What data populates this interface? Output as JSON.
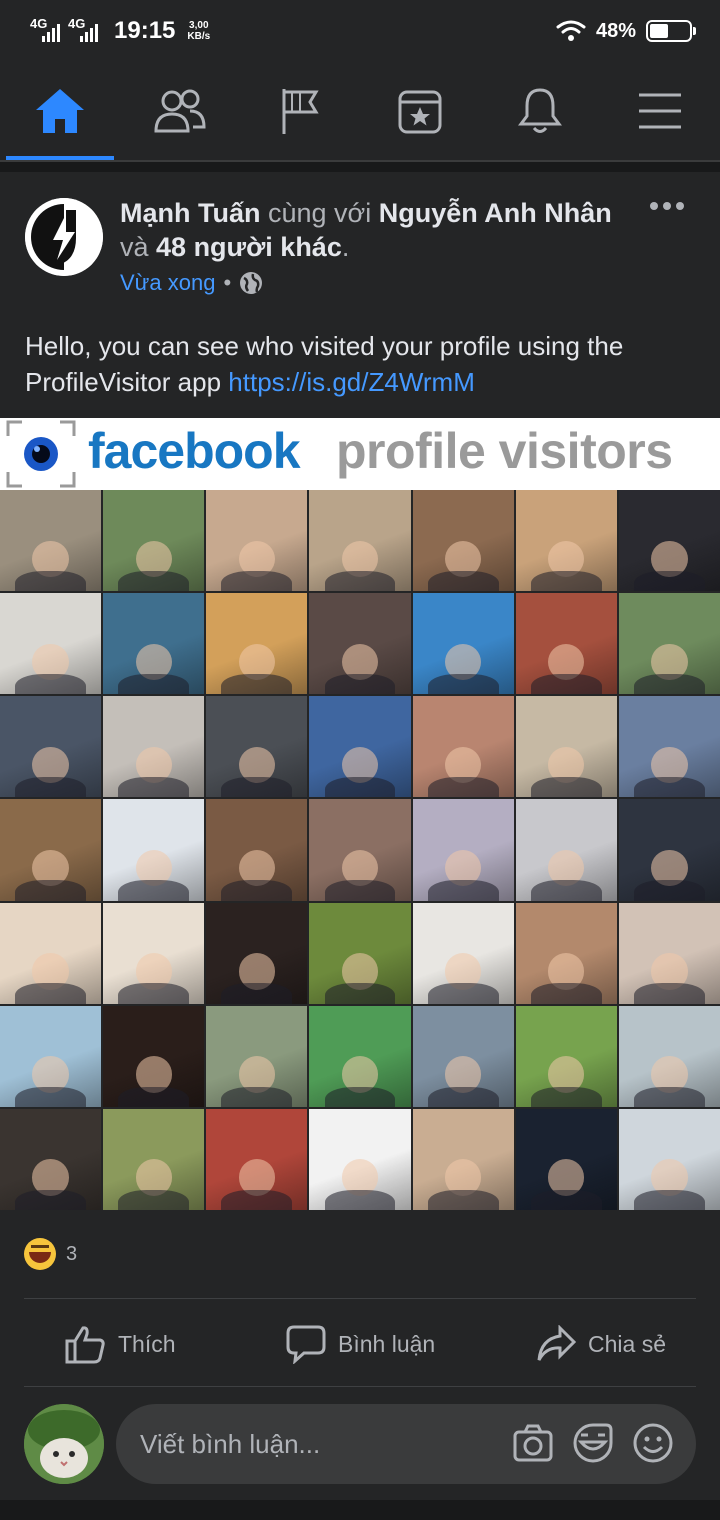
{
  "status": {
    "network1": "4G",
    "network2": "4G",
    "time": "19:15",
    "speed_value": "3,00",
    "speed_unit": "KB/s",
    "battery_pct": "48%",
    "battery_level": 0.48
  },
  "nav": {
    "items": [
      {
        "name": "home",
        "active": true
      },
      {
        "name": "friends",
        "active": false
      },
      {
        "name": "pages",
        "active": false
      },
      {
        "name": "events",
        "active": false
      },
      {
        "name": "notifications",
        "active": false
      },
      {
        "name": "menu",
        "active": false
      }
    ],
    "accent": "#2d88ff"
  },
  "post": {
    "author": "Mạnh Tuấn",
    "with_text": " cùng với ",
    "tagged": "Nguyễn Anh Nhân",
    "and_text": "và ",
    "others": "48 người khác",
    "period": ".",
    "time": "Vừa xong",
    "privacy_icon": "globe-icon",
    "text": "Hello, you can see who visited your profile using the ProfileVisitor app ",
    "link": "https://is.gd/Z4WrmM",
    "banner": {
      "brand": "facebook",
      "title": "profile visitors"
    },
    "reactions": {
      "emoji": "haha",
      "count": "3"
    },
    "actions": {
      "like": "Thích",
      "comment": "Bình luận",
      "share": "Chia sẻ"
    },
    "comment_placeholder": "Viết bình luận..."
  },
  "photo_grid": {
    "rows": 7,
    "columns": 7,
    "tile_colors": [
      "#9a8f7e",
      "#6e8a5a",
      "#c7a98f",
      "#b9a48a",
      "#8c6a50",
      "#c9a27a",
      "#2a2a30",
      "#d9d7d2",
      "#3f6f8e",
      "#d3a05a",
      "#5a4a46",
      "#3a86c8",
      "#a5503e",
      "#6e8b5d",
      "#4a5566",
      "#c4bfb9",
      "#4b4f55",
      "#3f66a0",
      "#b98570",
      "#c6b9a4",
      "#6a7fa0",
      "#8a6a4a",
      "#dfe4ea",
      "#7a5a44",
      "#8b6f63",
      "#b4aec2",
      "#c8c8cc",
      "#2e3440",
      "#e6d6c4",
      "#e9dfd2",
      "#2b2220",
      "#6d8a3c",
      "#e8e6e2",
      "#b3896c",
      "#d2c2b6",
      "#9fc0d6",
      "#2a1e1a",
      "#8a9a7e",
      "#4f9c56",
      "#7d8fa0",
      "#77a34e",
      "#b7c3c9",
      "#3a3430",
      "#8b9a5c",
      "#b0463a",
      "#f2f2f2",
      "#c9ad92",
      "#1a2230",
      "#cfd6dc"
    ]
  }
}
